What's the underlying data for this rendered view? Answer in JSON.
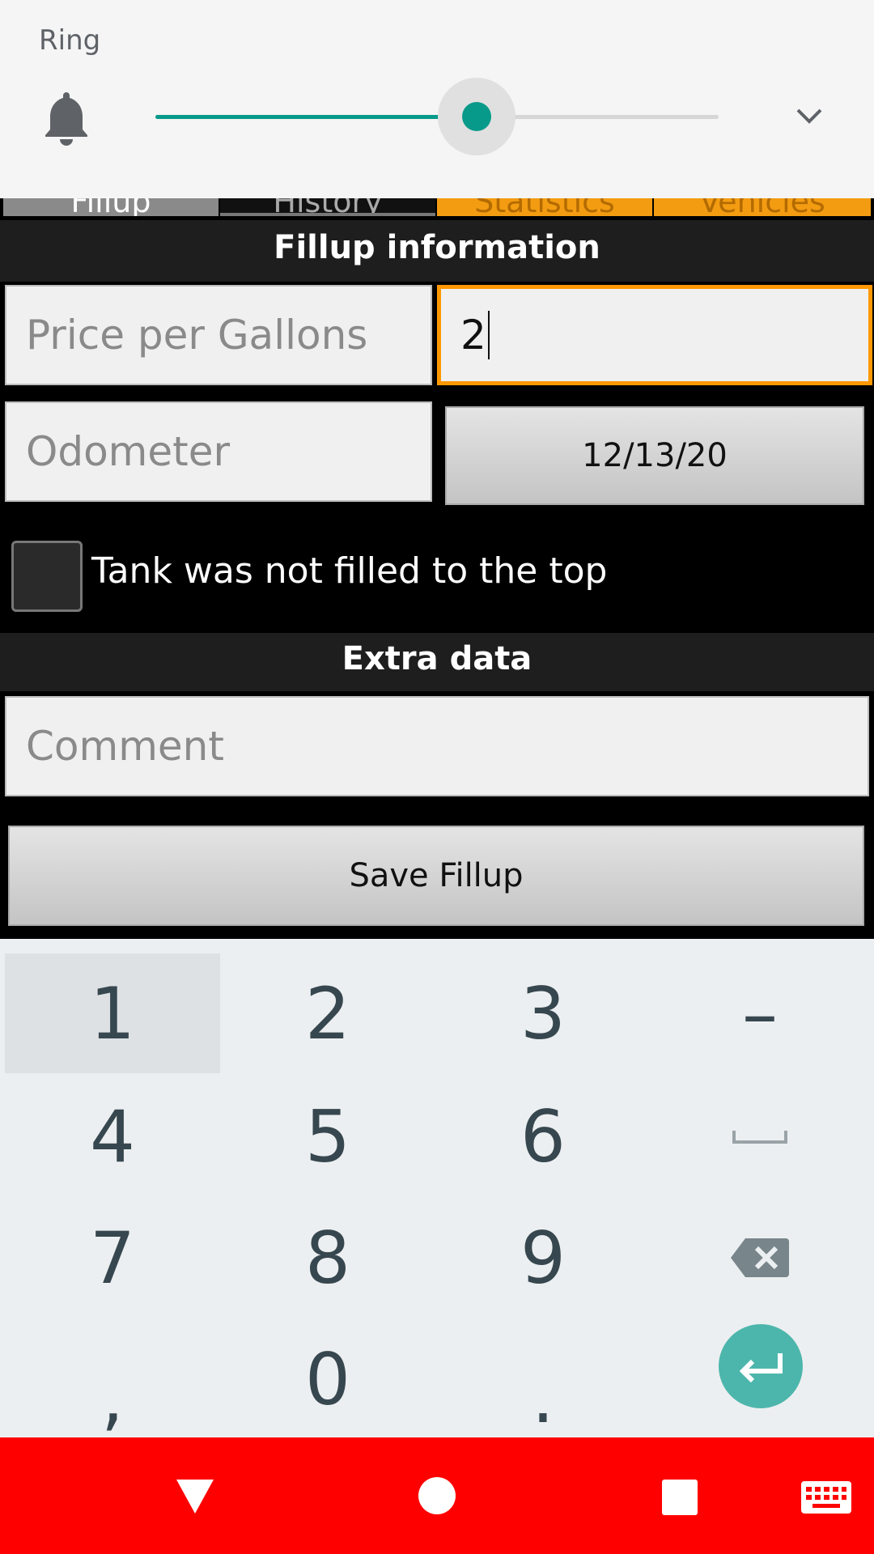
{
  "volume_panel": {
    "label": "Ring",
    "icon": "bell-icon",
    "level_percent": 57,
    "expand_icon": "chevron-down-icon",
    "accent_color": "#079a8a"
  },
  "tabs": [
    {
      "label": "Fillup"
    },
    {
      "label": "History"
    },
    {
      "label": "Statistics"
    },
    {
      "label": "Vehicles"
    }
  ],
  "fillup_section": {
    "title": "Fillup information",
    "price_placeholder": "Price per Gallons",
    "gallons_value": "2",
    "odometer_placeholder": "Odometer",
    "date_button": "12/13/20",
    "checkbox_label": "Tank was not filled to the top",
    "checkbox_checked": false
  },
  "extra_section": {
    "title": "Extra data",
    "comment_placeholder": "Comment",
    "save_button": "Save Fillup"
  },
  "keyboard": {
    "rows": [
      [
        "1",
        "2",
        "3",
        "–"
      ],
      [
        "4",
        "5",
        "6",
        "␣"
      ],
      [
        "7",
        "8",
        "9",
        "⌫"
      ],
      [
        ",",
        "0",
        ".",
        "↵"
      ]
    ],
    "pressed_key": "1",
    "enter_color": "#4db6ac"
  },
  "navbar": {
    "background": "#ff0000",
    "icons": [
      "back-icon",
      "home-icon",
      "recents-icon",
      "keyboard-icon"
    ]
  }
}
